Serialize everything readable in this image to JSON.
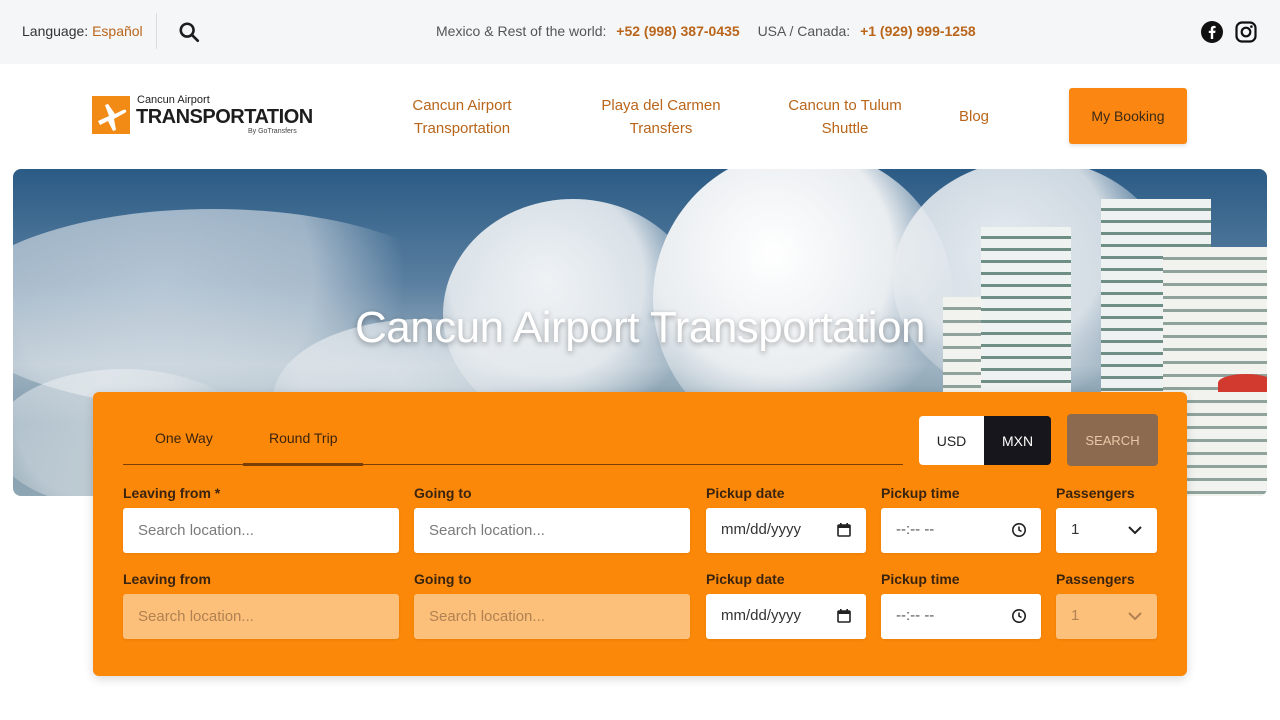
{
  "topbar": {
    "language_label": "Language:",
    "language_value": "Español",
    "phone_mx_label": "Mexico & Rest of the world:",
    "phone_mx": "+52 (998) 387-0435",
    "phone_us_label": "USA / Canada:",
    "phone_us": "+1 (929) 999-1258",
    "icons": [
      "search-icon",
      "facebook-icon",
      "instagram-icon"
    ]
  },
  "header": {
    "logo_line1": "Cancun Airport",
    "logo_line2": "TRANSPORTATION",
    "logo_line3": "By GoTransfers",
    "nav": [
      {
        "line1": "Cancun Airport",
        "line2": "Transportation"
      },
      {
        "line1": "Playa del Carmen",
        "line2": "Transfers"
      },
      {
        "line1": "Cancun to Tulum",
        "line2": "Shuttle"
      },
      {
        "line1": "Blog",
        "line2": ""
      }
    ],
    "booking_label": "My Booking"
  },
  "hero": {
    "title": "Cancun Airport Transportation"
  },
  "booking": {
    "tabs": [
      "One Way",
      "Round Trip"
    ],
    "active_tab": "Round Trip",
    "currency": [
      "USD",
      "MXN"
    ],
    "active_currency": "MXN",
    "search_label": "SEARCH",
    "row1": {
      "leaving_label": "Leaving from *",
      "leaving_placeholder": "Search location...",
      "going_label": "Going to",
      "going_placeholder": "Search location...",
      "date_label": "Pickup date",
      "date_value": "mm/dd/yyyy",
      "time_label": "Pickup time",
      "time_value": "--:-- --",
      "pax_label": "Passengers",
      "pax_value": "1"
    },
    "row2": {
      "leaving_label": "Leaving from",
      "leaving_placeholder": "Search location...",
      "going_label": "Going to",
      "going_placeholder": "Search location...",
      "date_label": "Pickup date",
      "date_value": "mm/dd/yyyy",
      "time_label": "Pickup time",
      "time_value": "--:-- --",
      "pax_label": "Passengers",
      "pax_value": "1"
    }
  },
  "colors": {
    "accent": "#fb8808",
    "link": "#b9651a",
    "dark": "#17161c"
  }
}
